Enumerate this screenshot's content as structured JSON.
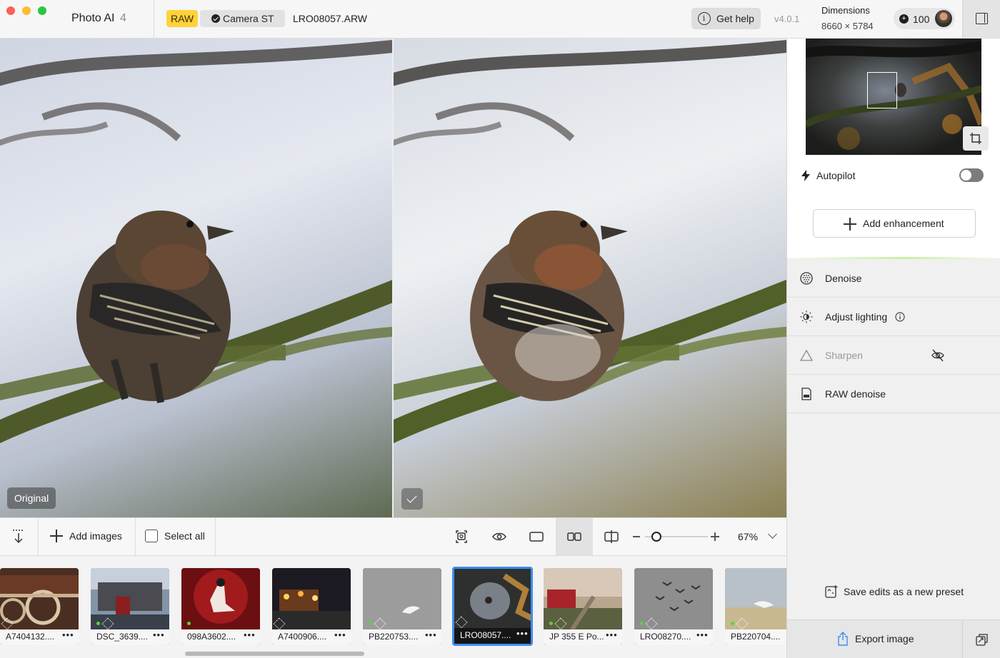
{
  "app": {
    "title": "Photo AI",
    "version_badge": "4",
    "raw_badge": "RAW",
    "camera_badge": "Camera ST",
    "filename": "LRO08057.ARW",
    "help_label": "Get help",
    "version": "v4.0.1",
    "dimensions_label": "Dimensions",
    "dimensions_value": "8660 × 5784",
    "credits": "100"
  },
  "preview": {
    "original_label": "Original"
  },
  "toolbar": {
    "add_images_label": "Add images",
    "select_all_label": "Select all",
    "zoom_value": "67%",
    "zoom_level": 0.18
  },
  "filmstrip": {
    "items": [
      {
        "name": "A7404132....",
        "more": "•••",
        "selected": false,
        "raw": true,
        "done": false
      },
      {
        "name": "DSC_3639....",
        "more": "•••",
        "selected": false,
        "raw": true,
        "done": true
      },
      {
        "name": "098A3602....",
        "more": "•••",
        "selected": false,
        "raw": false,
        "done": true
      },
      {
        "name": "A7400906....",
        "more": "•••",
        "selected": false,
        "raw": true,
        "done": false
      },
      {
        "name": "PB220753....",
        "more": "•••",
        "selected": false,
        "raw": true,
        "done": true
      },
      {
        "name": "LRO08057....",
        "more": "•••",
        "selected": true,
        "raw": true,
        "done": false
      },
      {
        "name": "JP 355 E Po...",
        "more": "•••",
        "selected": false,
        "raw": true,
        "done": true
      },
      {
        "name": "LRO08270....",
        "more": "•••",
        "selected": false,
        "raw": true,
        "done": true
      },
      {
        "name": "PB220704....",
        "more": "•••",
        "selected": false,
        "raw": true,
        "done": true
      }
    ]
  },
  "sidepanel": {
    "autopilot_label": "Autopilot",
    "add_enhancement_label": "Add enhancement",
    "enhancements": [
      {
        "label": "Denoise",
        "icon": "denoise-icon"
      },
      {
        "label": "Adjust lighting",
        "icon": "lighting-icon"
      },
      {
        "label": "Sharpen",
        "icon": "sharpen-icon"
      },
      {
        "label": "RAW denoise",
        "icon": "raw-denoise-icon"
      }
    ],
    "save_preset_label": "Save edits as a new preset",
    "export_label": "Export image"
  },
  "colors": {
    "accent_selected": "#3d8ef0",
    "raw_badge": "#ffd23c",
    "done_dot": "#53d63a"
  }
}
